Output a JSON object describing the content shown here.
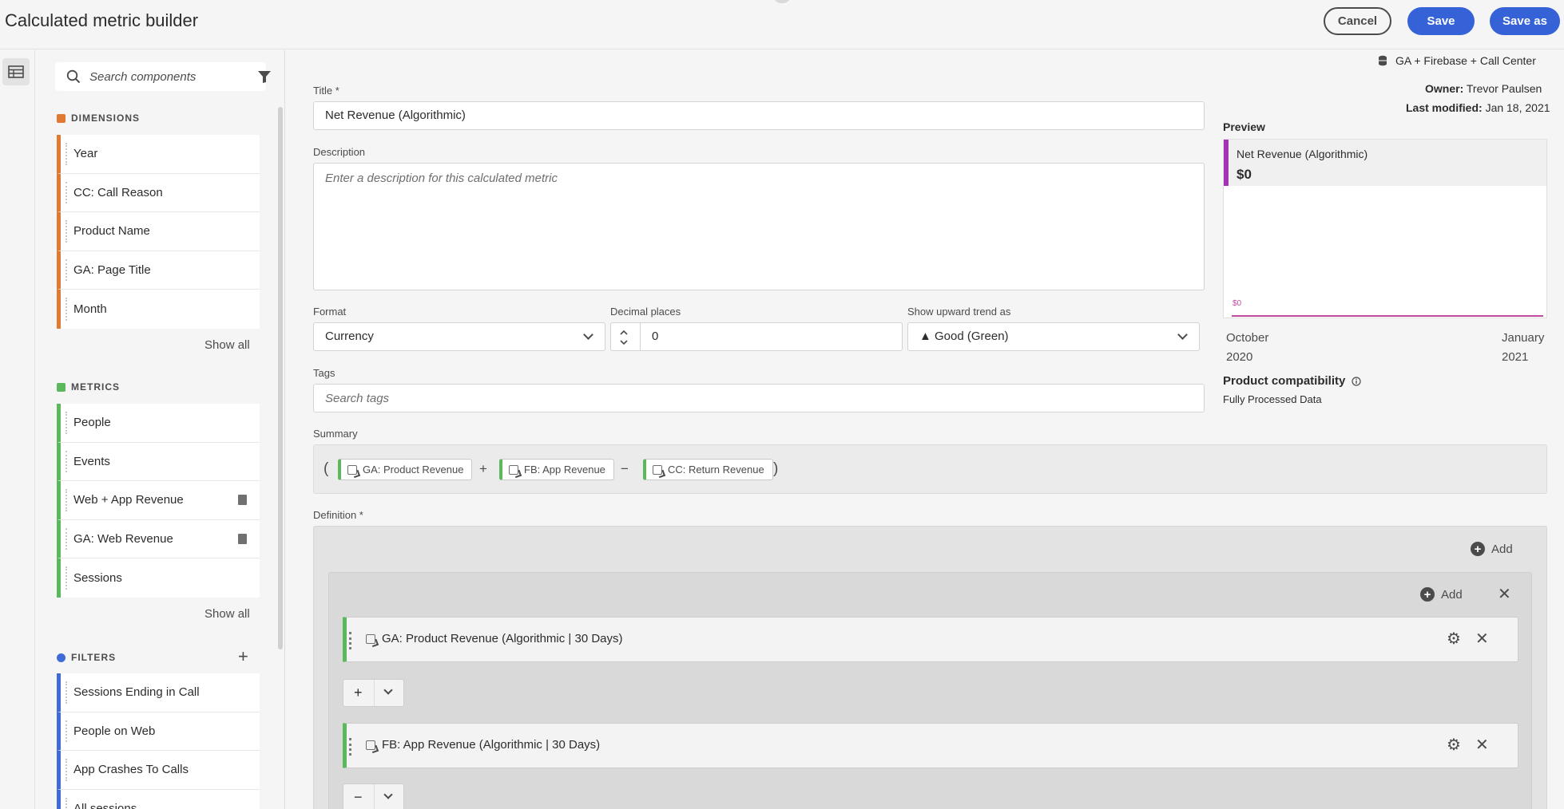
{
  "header": {
    "title": "Calculated metric builder",
    "cancel_label": "Cancel",
    "save_label": "Save",
    "save_as_label": "Save as"
  },
  "panel": {
    "search_placeholder": "Search components",
    "dimensions": {
      "title": "DIMENSIONS",
      "items": [
        "Year",
        "CC: Call Reason",
        "Product Name",
        "GA: Page Title",
        "Month"
      ],
      "show_all": "Show all"
    },
    "metrics": {
      "title": "METRICS",
      "items": [
        "People",
        "Events",
        "Web + App Revenue",
        "GA: Web Revenue",
        "Sessions"
      ],
      "show_all": "Show all"
    },
    "filters": {
      "title": "FILTERS",
      "items": [
        "Sessions Ending in Call",
        "People on Web",
        "App Crashes To Calls",
        "All sessions"
      ]
    }
  },
  "form": {
    "title_label": "Title *",
    "title_value": "Net Revenue (Algorithmic)",
    "description_label": "Description",
    "description_placeholder": "Enter a description for this calculated metric",
    "format_label": "Format",
    "format_value": "Currency",
    "decimal_label": "Decimal places",
    "decimal_value": "0",
    "trend_label": "Show upward trend as",
    "trend_value": "▲ Good (Green)",
    "tags_label": "Tags",
    "tags_placeholder": "Search tags",
    "summary_label": "Summary",
    "summary": {
      "open_paren": "(",
      "close_paren": ")",
      "chips": [
        "GA: Product Revenue",
        "FB: App Revenue",
        "CC: Return Revenue"
      ],
      "ops": [
        "+",
        "−"
      ]
    },
    "definition_label": "Definition *",
    "definition": {
      "add_label": "Add",
      "inner_add_label": "Add",
      "rows": [
        "GA: Product Revenue (Algorithmic | 30 Days)",
        "FB: App Revenue (Algorithmic | 30 Days)"
      ],
      "operators": [
        "+",
        "−"
      ]
    }
  },
  "side": {
    "data_view": "GA + Firebase + Call Center",
    "owner_label": "Owner:",
    "owner_value": "Trevor Paulsen",
    "modified_label": "Last modified:",
    "modified_value": "Jan 18, 2021",
    "preview_label": "Preview",
    "preview_metric": "Net Revenue (Algorithmic)",
    "preview_value": "$0",
    "preview_axis_zero": "$0",
    "axis_start_month": "October",
    "axis_start_year": "2020",
    "axis_end_month": "January",
    "axis_end_year": "2021",
    "compat_label": "Product compatibility",
    "compat_value": "Fully Processed Data"
  },
  "colors": {
    "accent": "#3562d6",
    "dimension": "#e07a33",
    "metric": "#5bb85b",
    "filter": "#3e6bd6",
    "preview_series": "#a335b3"
  }
}
